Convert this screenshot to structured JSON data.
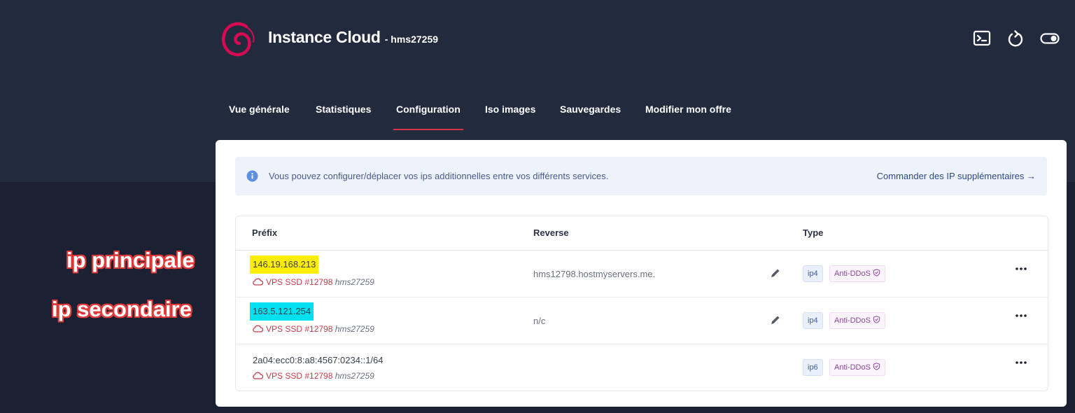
{
  "header": {
    "title": "Instance Cloud",
    "subtitle": "- hms27259",
    "icons": [
      "terminal-icon",
      "refresh-icon",
      "toggle-icon"
    ]
  },
  "nav": {
    "tabs": [
      {
        "label": "Vue générale",
        "active": false
      },
      {
        "label": "Statistiques",
        "active": false
      },
      {
        "label": "Configuration",
        "active": true
      },
      {
        "label": "Iso images",
        "active": false
      },
      {
        "label": "Sauvegardes",
        "active": false
      },
      {
        "label": "Modifier mon offre",
        "active": false
      }
    ]
  },
  "alert": {
    "text": "Vous pouvez configurer/déplacer vos ips additionnelles entre vos différents services.",
    "link": "Commander des IP supplémentaires →"
  },
  "table": {
    "headers": {
      "prefix": "Préfix",
      "reverse": "Reverse",
      "type": "Type"
    },
    "rows": [
      {
        "ip": "146.19.168.213",
        "service": "VPS SSD #12798",
        "user": "hms27259",
        "reverse": "hms12798.hostmyservers.me.",
        "ip_type": "ip4",
        "protection": "Anti-DDoS"
      },
      {
        "ip": "163.5.121.254",
        "service": "VPS SSD #12798",
        "user": "hms27259",
        "reverse": "n/c",
        "ip_type": "ip4",
        "protection": "Anti-DDoS"
      },
      {
        "ip": "2a04:ecc0:8:a8:4567:0234::1/64",
        "service": "VPS SSD #12798",
        "user": "hms27259",
        "reverse": "",
        "ip_type": "ip6",
        "protection": "Anti-DDoS"
      }
    ]
  },
  "annotations": {
    "primary": "ip principale",
    "secondary": "ip secondaire"
  },
  "colors": {
    "accent": "#d6334b",
    "highlight_primary": "#ffee00",
    "highlight_secondary": "#00e0ee",
    "annotation_outline": "#e13a3a"
  }
}
